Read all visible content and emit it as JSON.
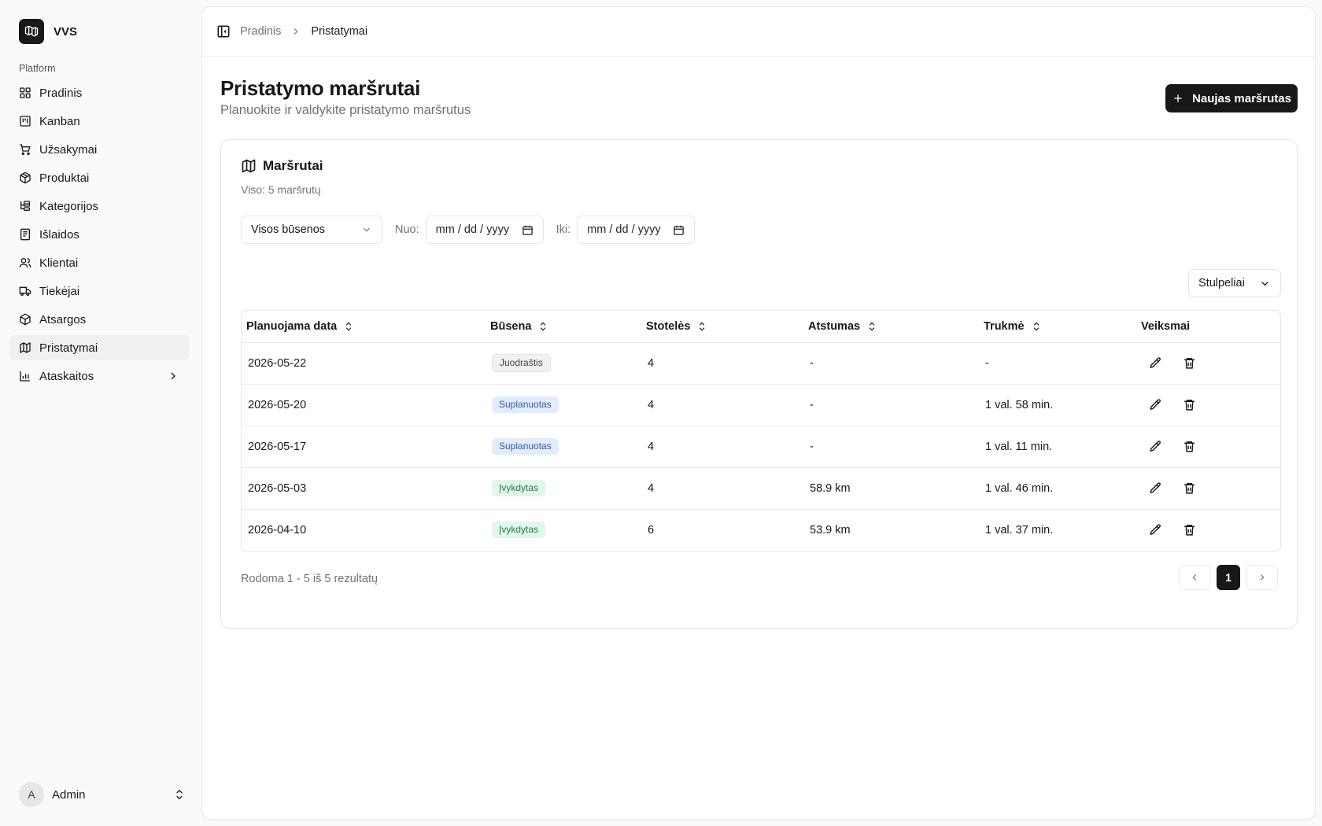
{
  "app": {
    "name": "VVS"
  },
  "sidebar": {
    "group_label": "Platform",
    "items": [
      {
        "label": "Pradinis",
        "icon": "layout-grid-icon"
      },
      {
        "label": "Kanban",
        "icon": "kanban-icon"
      },
      {
        "label": "Užsakymai",
        "icon": "shopping-cart-icon"
      },
      {
        "label": "Produktai",
        "icon": "package-icon"
      },
      {
        "label": "Kategorijos",
        "icon": "list-tree-icon"
      },
      {
        "label": "Išlaidos",
        "icon": "receipt-icon"
      },
      {
        "label": "Klientai",
        "icon": "users-icon"
      },
      {
        "label": "Tiekėjai",
        "icon": "truck-icon"
      },
      {
        "label": "Atsargos",
        "icon": "box-icon"
      },
      {
        "label": "Pristatymai",
        "icon": "map-icon",
        "active": true
      },
      {
        "label": "Ataskaitos",
        "icon": "bar-chart-icon",
        "expandable": true
      }
    ],
    "user": {
      "initial": "A",
      "name": "Admin"
    }
  },
  "breadcrumb": {
    "home": "Pradinis",
    "current": "Pristatymai"
  },
  "header": {
    "title": "Pristatymo maršrutai",
    "subtitle": "Planuokite ir valdykite pristatymo maršrutus",
    "new_button": "Naujas maršrutas"
  },
  "card": {
    "title": "Maršrutai",
    "subtitle": "Viso: 5 maršrutų"
  },
  "filters": {
    "status_select": "Visos būsenos",
    "from_label": "Nuo:",
    "from_value": "mm / dd / yyyy",
    "to_label": "Iki:",
    "to_value": "mm / dd / yyyy"
  },
  "columns_button": "Stulpeliai",
  "table": {
    "headers": [
      "Planuojama data",
      "Būsena",
      "Stotelės",
      "Atstumas",
      "Trukmė",
      "Veiksmai"
    ],
    "rows": [
      {
        "date": "2026-05-22",
        "status": "Juodraštis",
        "status_kind": "draft",
        "stops": "4",
        "distance": "-",
        "duration": "-"
      },
      {
        "date": "2026-05-20",
        "status": "Suplanuotas",
        "status_kind": "planned",
        "stops": "4",
        "distance": "-",
        "duration": "1 val. 58 min."
      },
      {
        "date": "2026-05-17",
        "status": "Suplanuotas",
        "status_kind": "planned",
        "stops": "4",
        "distance": "-",
        "duration": "1 val. 11 min."
      },
      {
        "date": "2026-05-03",
        "status": "Įvykdytas",
        "status_kind": "done",
        "stops": "4",
        "distance": "58.9 km",
        "duration": "1 val. 46 min."
      },
      {
        "date": "2026-04-10",
        "status": "Įvykdytas",
        "status_kind": "done",
        "stops": "6",
        "distance": "53.9 km",
        "duration": "1 val. 37 min."
      }
    ]
  },
  "pagination": {
    "summary": "Rodoma 1 - 5 iš 5 rezultatų",
    "current_page": "1"
  },
  "colors": {
    "draft_bg": "#f1f1f3",
    "draft_fg": "#3f3f46",
    "planned_bg": "#e3ecfb",
    "planned_fg": "#2e5aac",
    "done_bg": "#e2f6e9",
    "done_fg": "#247a44",
    "primary": "#18181b"
  }
}
